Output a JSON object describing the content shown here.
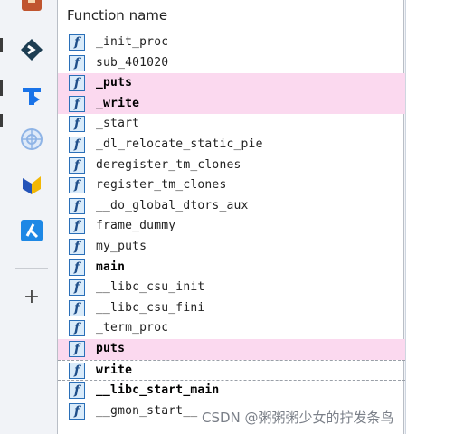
{
  "header": {
    "title": "Function name"
  },
  "function_icon": "f",
  "functions": [
    {
      "name": "_init_proc",
      "bold": false,
      "highlight": false
    },
    {
      "name": "sub_401020",
      "bold": false,
      "highlight": false
    },
    {
      "name": "_puts",
      "bold": true,
      "highlight": true
    },
    {
      "name": "_write",
      "bold": true,
      "highlight": true
    },
    {
      "name": "_start",
      "bold": false,
      "highlight": false
    },
    {
      "name": "_dl_relocate_static_pie",
      "bold": false,
      "highlight": false
    },
    {
      "name": "deregister_tm_clones",
      "bold": false,
      "highlight": false
    },
    {
      "name": "register_tm_clones",
      "bold": false,
      "highlight": false
    },
    {
      "name": "__do_global_dtors_aux",
      "bold": false,
      "highlight": false
    },
    {
      "name": "frame_dummy",
      "bold": false,
      "highlight": false
    },
    {
      "name": "my_puts",
      "bold": false,
      "highlight": false
    },
    {
      "name": "main",
      "bold": true,
      "highlight": false
    },
    {
      "name": "__libc_csu_init",
      "bold": false,
      "highlight": false
    },
    {
      "name": "__libc_csu_fini",
      "bold": false,
      "highlight": false
    },
    {
      "name": "_term_proc",
      "bold": false,
      "highlight": false
    },
    {
      "name": "puts",
      "bold": true,
      "highlight": true
    },
    {
      "name": "write",
      "bold": true,
      "highlight": false
    },
    {
      "name": "__libc_start_main",
      "bold": true,
      "highlight": false
    },
    {
      "name": "__gmon_start__",
      "bold": false,
      "highlight": false
    }
  ],
  "dock": {
    "add_label": "+",
    "icons": [
      "toolbox-icon",
      "diamond-app-icon",
      "t-app-icon",
      "globe-app-icon",
      "bird-app-icon",
      "q-app-icon"
    ],
    "colors": {
      "toolbox": "#c0552f",
      "diamond": "#1d3d52",
      "t_app": "#1a73e8",
      "globe": "#8fb4e6",
      "bird_blue": "#2453b8",
      "bird_yellow": "#f2b705",
      "q_app": "#1e88e5"
    }
  },
  "colors": {
    "highlight": "#fbd9ef",
    "icon_fill": "#d9ebfa",
    "icon_border": "#2a6fb8"
  },
  "watermark": "CSDN @粥粥粥少女的拧发条鸟"
}
